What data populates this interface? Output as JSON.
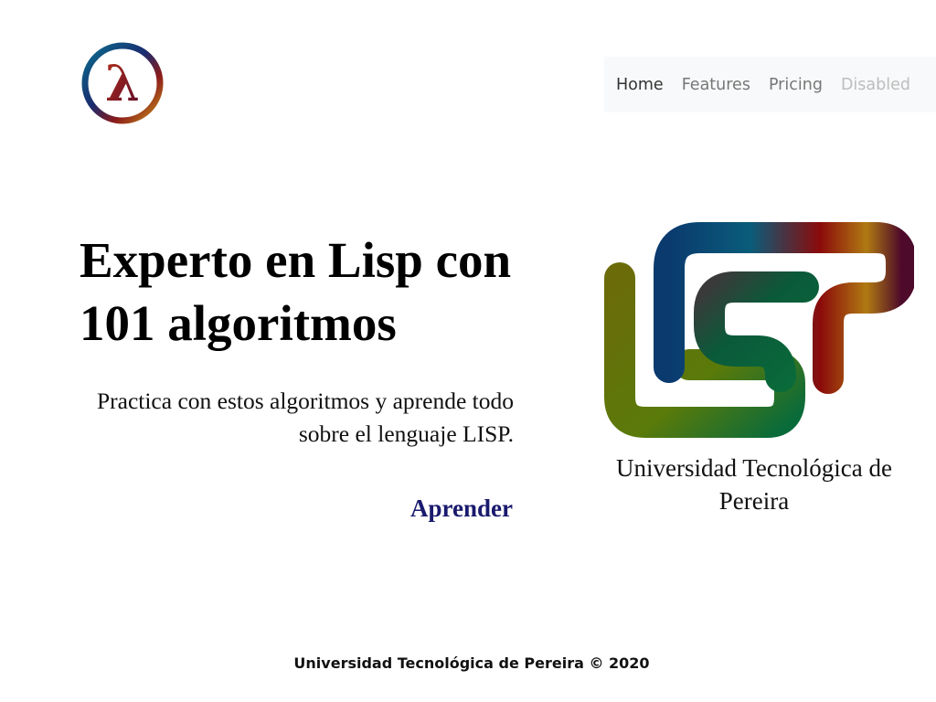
{
  "logo": {
    "icon": "lambda-logo-icon",
    "glyph": "λ"
  },
  "nav": {
    "items": [
      {
        "label": "Home",
        "state": "active"
      },
      {
        "label": "Features",
        "state": "normal"
      },
      {
        "label": "Pricing",
        "state": "normal"
      },
      {
        "label": "Disabled",
        "state": "disabled"
      }
    ]
  },
  "hero": {
    "title": "Experto en Lisp con 101 algoritmos",
    "subtitle": "Practica con estos algoritmos y aprende todo sobre el lenguaje LISP.",
    "cta_label": "Aprender"
  },
  "lisp_logo": {
    "icon": "lisp-logo-icon",
    "caption": "Universidad Tecnológica de Pereira"
  },
  "footer": {
    "text": "Universidad Tecnológica de Pereira © 2020"
  },
  "colors": {
    "navbar_bg": "#f8f9fa",
    "nav_active": "#333333",
    "nav_normal": "#777777",
    "nav_disabled": "#bdbdbd",
    "cta": "#1a1a6e",
    "gradient": [
      "#0a5c7a",
      "#8b1a1a",
      "#b07a12",
      "#4d0a2a",
      "#0a6b3a",
      "#6b6b0a"
    ]
  }
}
